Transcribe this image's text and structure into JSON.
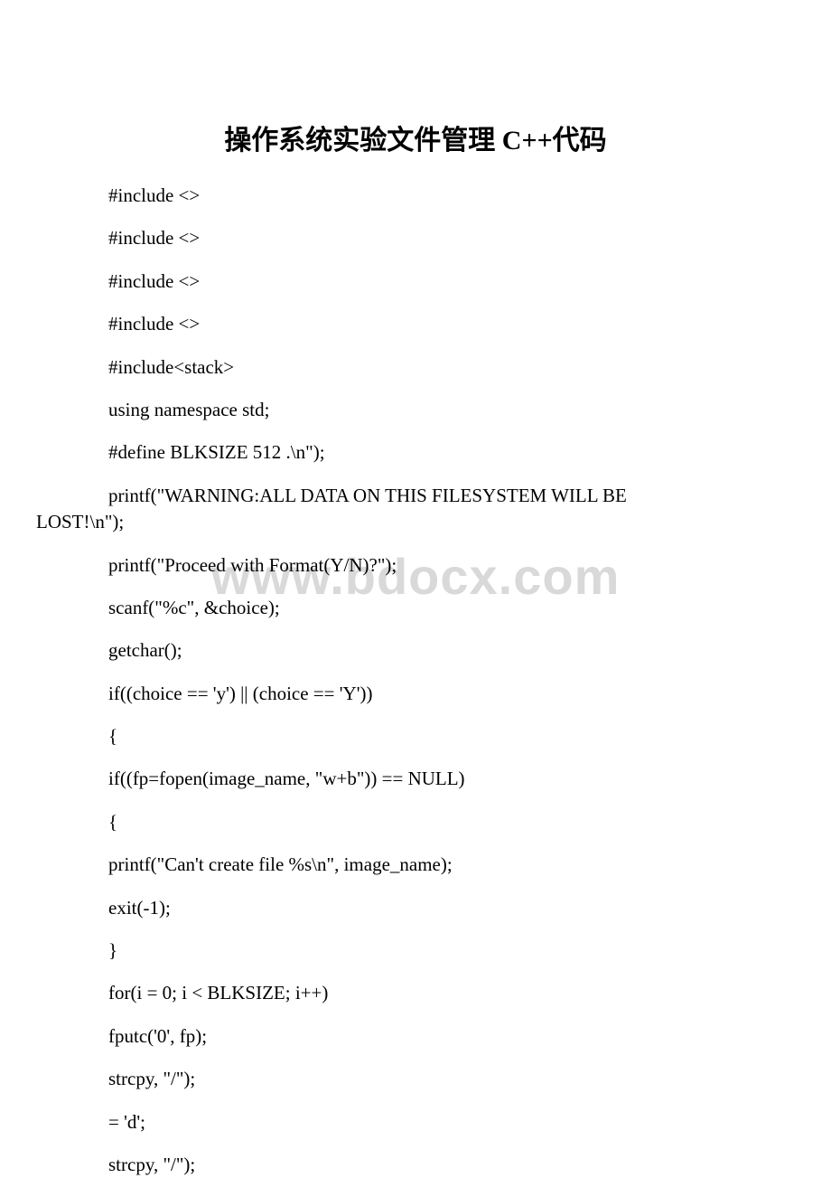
{
  "watermark": "www.bdocx.com",
  "title": "操作系统实验文件管理 C++代码",
  "lines": [
    "#include <>",
    "#include <>",
    "#include <>",
    "#include <>",
    "#include<stack>",
    "using namespace std;",
    "#define BLKSIZE 512 .\\n\");",
    "printf(\"WARNING:ALL DATA ON THIS FILESYSTEM WILL BE LOST!\\n\");",
    "printf(\"Proceed with Format(Y/N)?\");",
    "scanf(\"%c\", &choice);",
    "getchar();",
    "if((choice == 'y') || (choice == 'Y'))",
    "{",
    "if((fp=fopen(image_name, \"w+b\")) == NULL)",
    "{",
    "printf(\"Can't create file %s\\n\", image_name);",
    "exit(-1);",
    "}",
    "for(i = 0; i < BLKSIZE; i++)",
    "fputc('0', fp);",
    "strcpy, \"/\");",
    " = 'd';",
    "strcpy, \"/\");"
  ]
}
